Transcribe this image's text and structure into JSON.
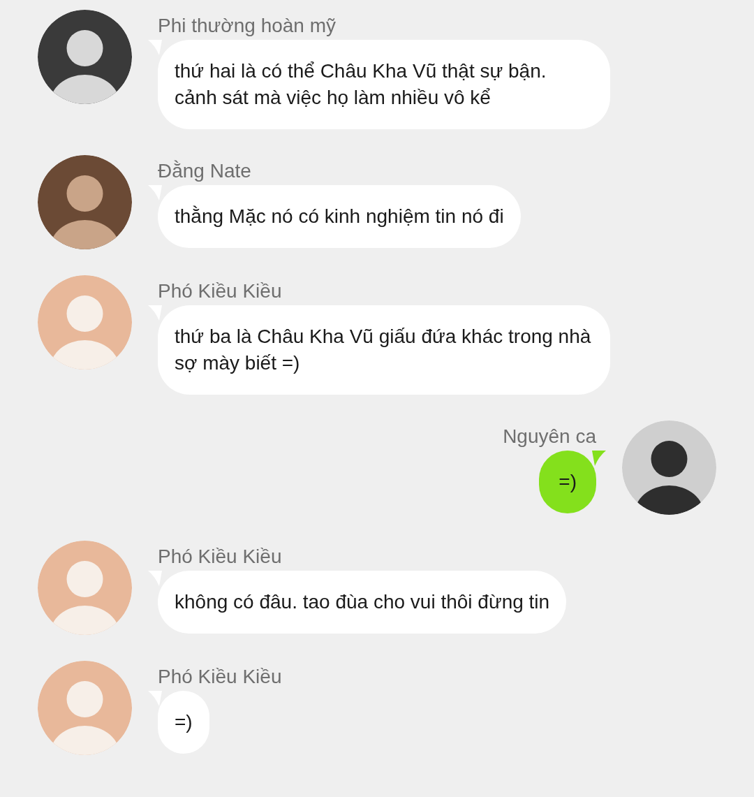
{
  "messages": [
    {
      "sender": "Phi thường hoàn mỹ",
      "outgoing": false,
      "text": "thứ hai là có thể Châu Kha Vũ thật sự bận. cảnh sát mà việc họ làm nhiều vô kể"
    },
    {
      "sender": "Đằng Nate",
      "outgoing": false,
      "text": "thằng Mặc nó có kinh nghiệm tin nó đi"
    },
    {
      "sender": "Phó Kiều Kiều",
      "outgoing": false,
      "text": "thứ ba là Châu Kha Vũ giấu đứa khác trong nhà sợ mày biết =)"
    },
    {
      "sender": "Nguyên ca",
      "outgoing": true,
      "text": "=)"
    },
    {
      "sender": "Phó Kiều Kiều",
      "outgoing": false,
      "text": "không có đâu. tao đùa cho vui thôi đừng tin"
    },
    {
      "sender": "Phó Kiều Kiều",
      "outgoing": false,
      "text": "=)"
    }
  ]
}
